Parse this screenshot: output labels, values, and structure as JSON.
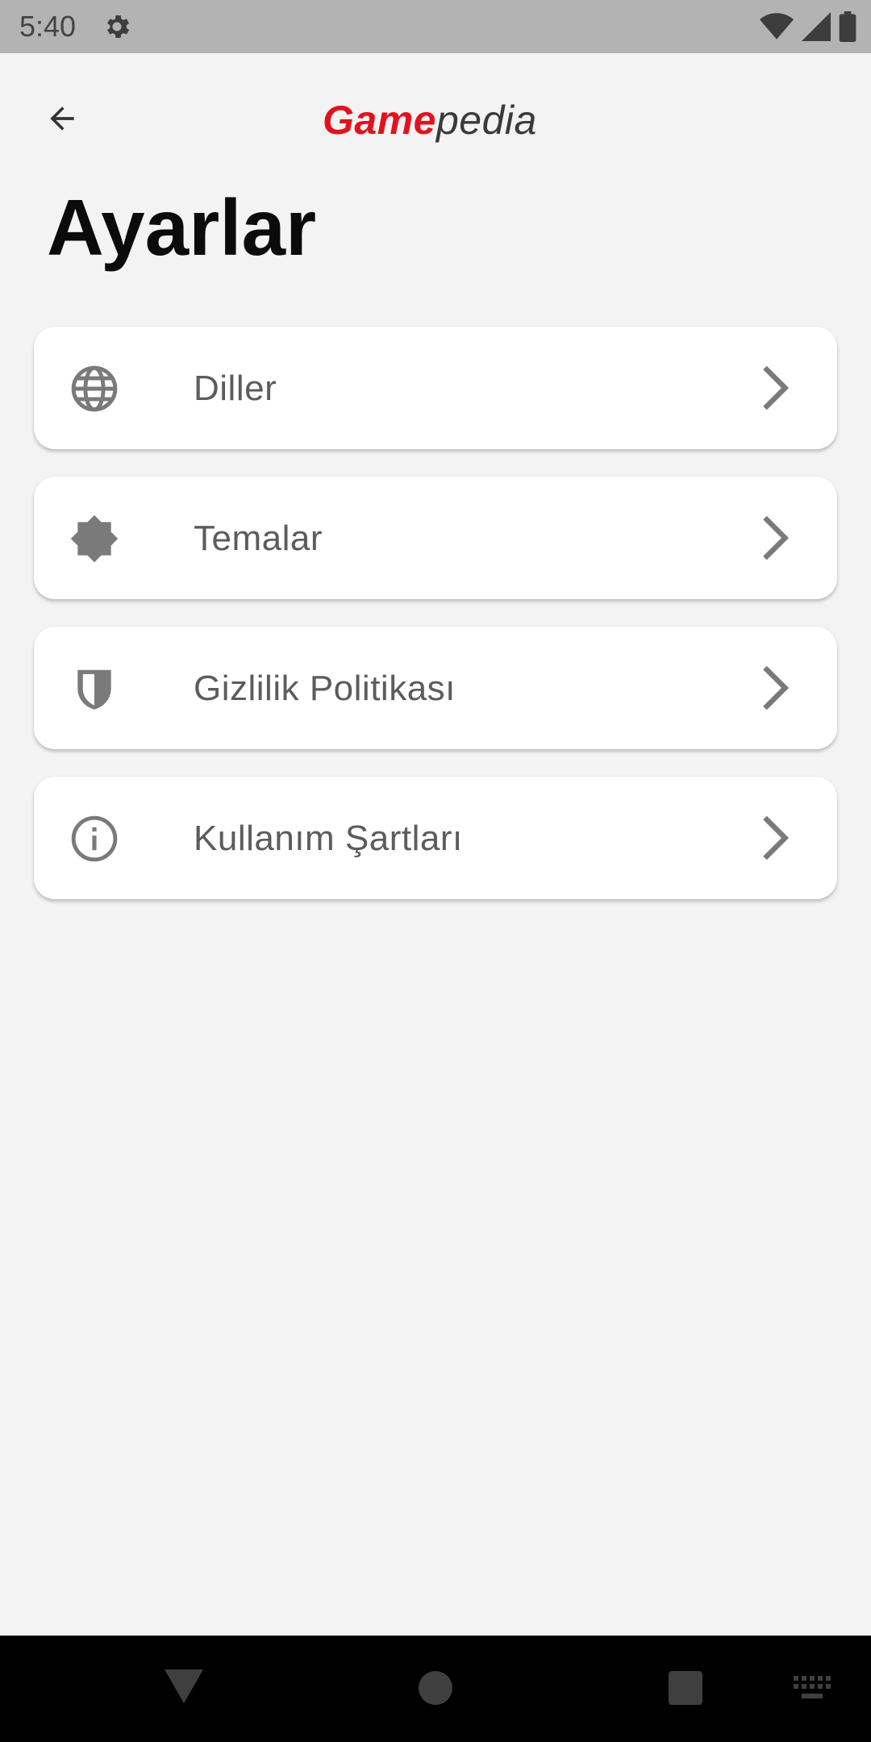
{
  "status_bar": {
    "time": "5:40",
    "icons": [
      "gear-icon",
      "wifi-icon",
      "signal-icon",
      "battery-icon"
    ]
  },
  "app_bar": {
    "back_icon": "arrow-left-icon",
    "logo_part1": "Game",
    "logo_part2": "pedia",
    "logo_color": "#e1121f"
  },
  "page": {
    "title": "Ayarlar"
  },
  "menu": {
    "items": [
      {
        "label": "Diller",
        "icon": "globe-icon"
      },
      {
        "label": "Temalar",
        "icon": "theme-brightness-icon"
      },
      {
        "label": "Gizlilik Politikası",
        "icon": "shield-icon"
      },
      {
        "label": "Kullanım Şartları",
        "icon": "info-icon"
      }
    ],
    "chevron_icon": "chevron-right-icon"
  },
  "nav_bar": {
    "icons": [
      "nav-back-icon",
      "nav-home-icon",
      "nav-recent-icon",
      "keyboard-icon"
    ]
  },
  "colors": {
    "background": "#f3f3f3",
    "card": "#ffffff",
    "text_primary": "#0b0b0b",
    "text_secondary": "#5c5c5c",
    "icon_gray": "#7a7a7a"
  }
}
